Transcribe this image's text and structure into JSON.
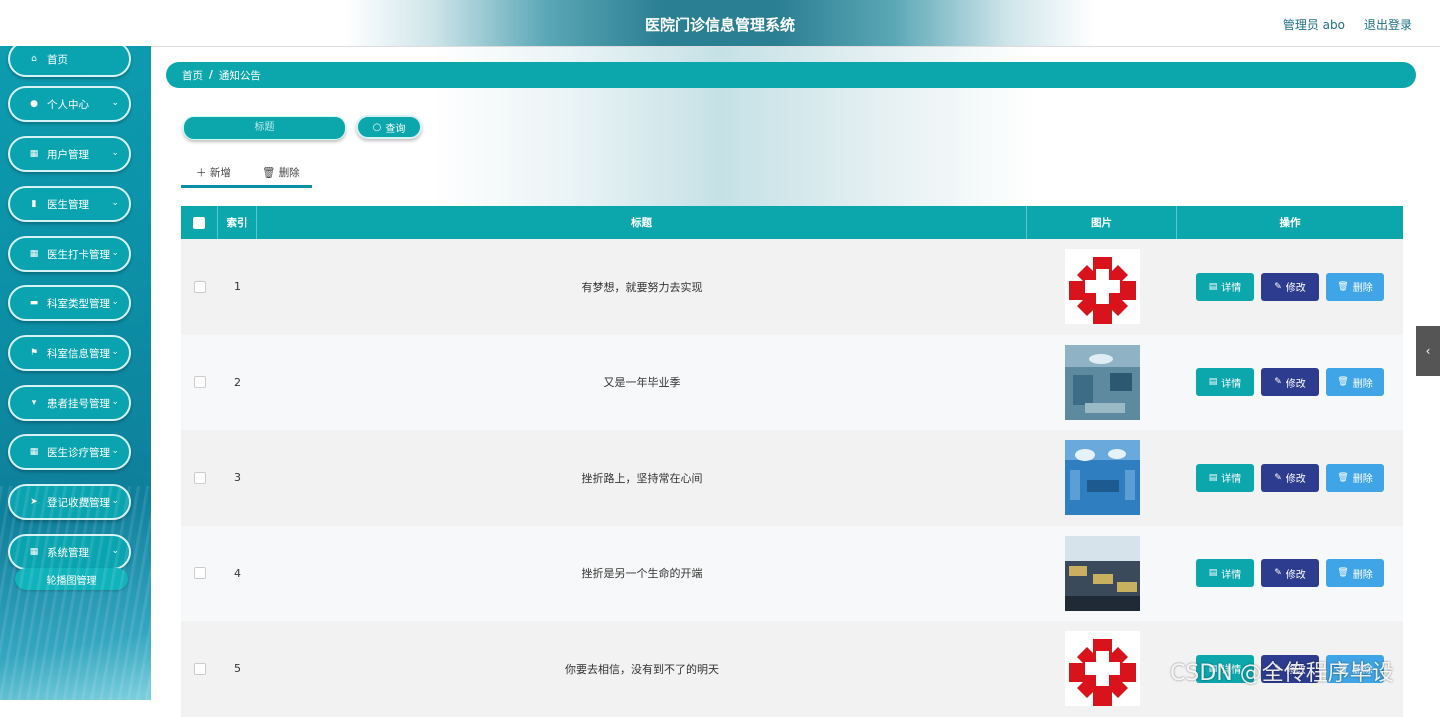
{
  "header": {
    "app_title": "医院门诊信息管理系统",
    "admin_label": "管理员 abo",
    "logout": "退出登录"
  },
  "sidebar": {
    "items": [
      {
        "label": "首页",
        "icon": "home-icon",
        "expandable": false
      },
      {
        "label": "个人中心",
        "icon": "user-icon",
        "expandable": true
      },
      {
        "label": "用户管理",
        "icon": "grid-icon",
        "expandable": true
      },
      {
        "label": "医生管理",
        "icon": "clipboard-icon",
        "expandable": true
      },
      {
        "label": "医生打卡管理",
        "icon": "table-icon",
        "expandable": true
      },
      {
        "label": "科室类型管理",
        "icon": "chat-icon",
        "expandable": true
      },
      {
        "label": "科室信息管理",
        "icon": "flag-icon",
        "expandable": true
      },
      {
        "label": "患者挂号管理",
        "icon": "stamp-icon",
        "expandable": true
      },
      {
        "label": "医生诊疗管理",
        "icon": "grid-icon",
        "expandable": true
      },
      {
        "label": "登记收费管理",
        "icon": "send-icon",
        "expandable": true
      },
      {
        "label": "系统管理",
        "icon": "grid-icon",
        "expandable": true
      }
    ],
    "sub_item": "轮播图管理"
  },
  "breadcrumb": {
    "home": "首页",
    "sep": "/",
    "current": "通知公告"
  },
  "search": {
    "placeholder": "标题",
    "button": "查询"
  },
  "toolbar": {
    "add": "新增",
    "delete": "删除"
  },
  "table": {
    "headers": {
      "index": "索引",
      "title": "标题",
      "image": "图片",
      "actions": "操作"
    },
    "rows": [
      {
        "index": "1",
        "title": "有梦想，就要努力去实现",
        "image": "red-cross-logo"
      },
      {
        "index": "2",
        "title": "又是一年毕业季",
        "image": "operating-room-photo"
      },
      {
        "index": "3",
        "title": "挫折路上，坚持常在心间",
        "image": "operating-room-blue-photo"
      },
      {
        "index": "4",
        "title": "挫折是另一个生命的开端",
        "image": "ward-photo"
      },
      {
        "index": "5",
        "title": "你要去相信，没有到不了的明天",
        "image": "red-cross-logo"
      }
    ],
    "actions": {
      "detail": "详情",
      "edit": "修改",
      "delete": "删除"
    }
  },
  "watermark": "CSDN @全传程序毕设",
  "colors": {
    "accent": "#0ca6ad",
    "edit": "#2e3c8f",
    "delete": "#3fa5e6",
    "sidebar": "#0c8fa6"
  }
}
